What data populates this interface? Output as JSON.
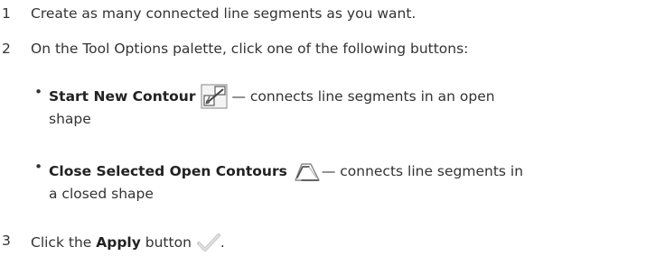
{
  "steps": [
    {
      "number": "1",
      "text": "Create as many connected line segments as you want."
    },
    {
      "number": "2",
      "text": "On the Tool Options palette, click one of the following buttons:"
    },
    {
      "number": "3",
      "prefix": "Click the ",
      "bold": "Apply",
      "suffix": " button",
      "end": "."
    }
  ],
  "bullets": [
    {
      "bullet": "•",
      "title": "Start New Contour",
      "icon": "start-new-contour-icon",
      "desc": " — connects line segments in an open",
      "desc2": "shape"
    },
    {
      "bullet": "•",
      "title": "Close Selected Open Contours",
      "icon": "close-contours-icon",
      "desc": " — connects line segments in",
      "desc2": "a closed shape"
    }
  ],
  "apply_icon": "checkmark-icon"
}
